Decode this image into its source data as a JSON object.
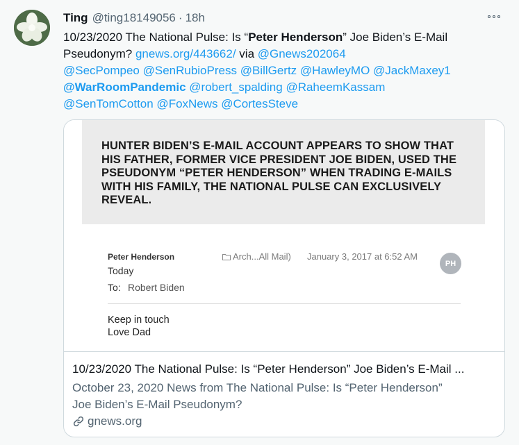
{
  "tweet": {
    "display_name": "Ting",
    "handle": "@ting18149056",
    "separator": "·",
    "time": "18h",
    "more_icon": "more-horizontal-icon",
    "text": {
      "line1_prefix": "10/23/2020 The National Pulse: Is “",
      "line1_bold": "Peter Henderson",
      "line1_suffix": "” Joe Biden’s E-Mail",
      "line2_prefix": "Pseudonym? ",
      "line2_link": "gnews.org/443662/",
      "line2_mid": " via ",
      "line2_mention": "@Gnews202064",
      "line3": "@SecPompeo @SenRubioPress @BillGertz @HawleyMO @JackMaxey1",
      "line4_bold": "@WarRoomPandemic",
      "line4_rest": " @robert_spalding @RaheemKassam",
      "line5": "@SenTomCotton @FoxNews @CortesSteve"
    }
  },
  "card": {
    "headline_lines": [
      "HUNTER BIDEN’S E-MAIL ACCOUNT APPEARS TO SHOW THAT",
      "HIS FATHER, FORMER VICE PRESIDENT JOE BIDEN, USED THE",
      "PSEUDONYM “PETER HENDERSON” WHEN TRADING E-MAILS",
      "WITH HIS FAMILY, THE NATIONAL PULSE CAN EXCLUSIVELY",
      "REVEAL."
    ],
    "email": {
      "from": "Peter Henderson",
      "today": "Today",
      "to_label": "To:",
      "to_value": "Robert Biden",
      "folder": "Arch...All Mail)",
      "date": "January 3, 2017 at 6:52 AM",
      "badge": "PH",
      "body_line1": "Keep in touch",
      "body_line2": "Love Dad"
    },
    "title": "10/23/2020 The National Pulse: Is “Peter Henderson” Joe Biden’s E-Mail ...",
    "description_lines": [
      "October 23, 2020 News from The National Pulse: Is “Peter Henderson”",
      "Joe Biden’s E-Mail Pseudonym?"
    ],
    "domain": "gnews.org",
    "domain_icon": "link-icon"
  },
  "colors": {
    "link": "#1d9bf0",
    "secondary_text": "#536471",
    "background": "#f7f9f9"
  }
}
